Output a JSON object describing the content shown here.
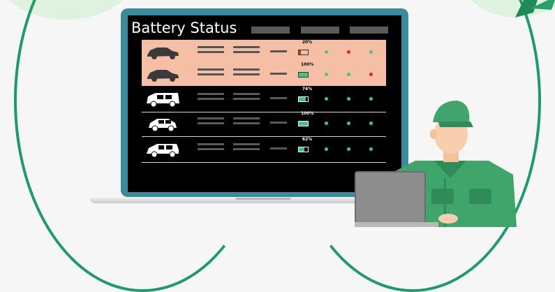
{
  "screen": {
    "title": "Battery Status"
  },
  "rows": [
    {
      "vehicle": "sedan",
      "percent": "20%",
      "level": 0.2,
      "status": [
        "green",
        "red",
        "green"
      ],
      "highlighted": true
    },
    {
      "vehicle": "sedan",
      "percent": "100%",
      "level": 1.0,
      "status": [
        "green",
        "green",
        "red"
      ],
      "highlighted": true
    },
    {
      "vehicle": "van",
      "percent": "74%",
      "level": 0.74,
      "status": [
        "green",
        "green",
        "green"
      ],
      "highlighted": false
    },
    {
      "vehicle": "hatchback",
      "percent": "100%",
      "level": 1.0,
      "status": [
        "green",
        "green",
        "green"
      ],
      "highlighted": false
    },
    {
      "vehicle": "minivan",
      "percent": "62%",
      "level": 0.62,
      "status": [
        "green",
        "green",
        "green"
      ],
      "highlighted": false
    }
  ],
  "colors": {
    "green": "#39c98f",
    "red": "#e52525",
    "highlight_row": "#f4bfa4",
    "accent_frame": "#1c9b6c",
    "uniform": "#3fa56a"
  }
}
